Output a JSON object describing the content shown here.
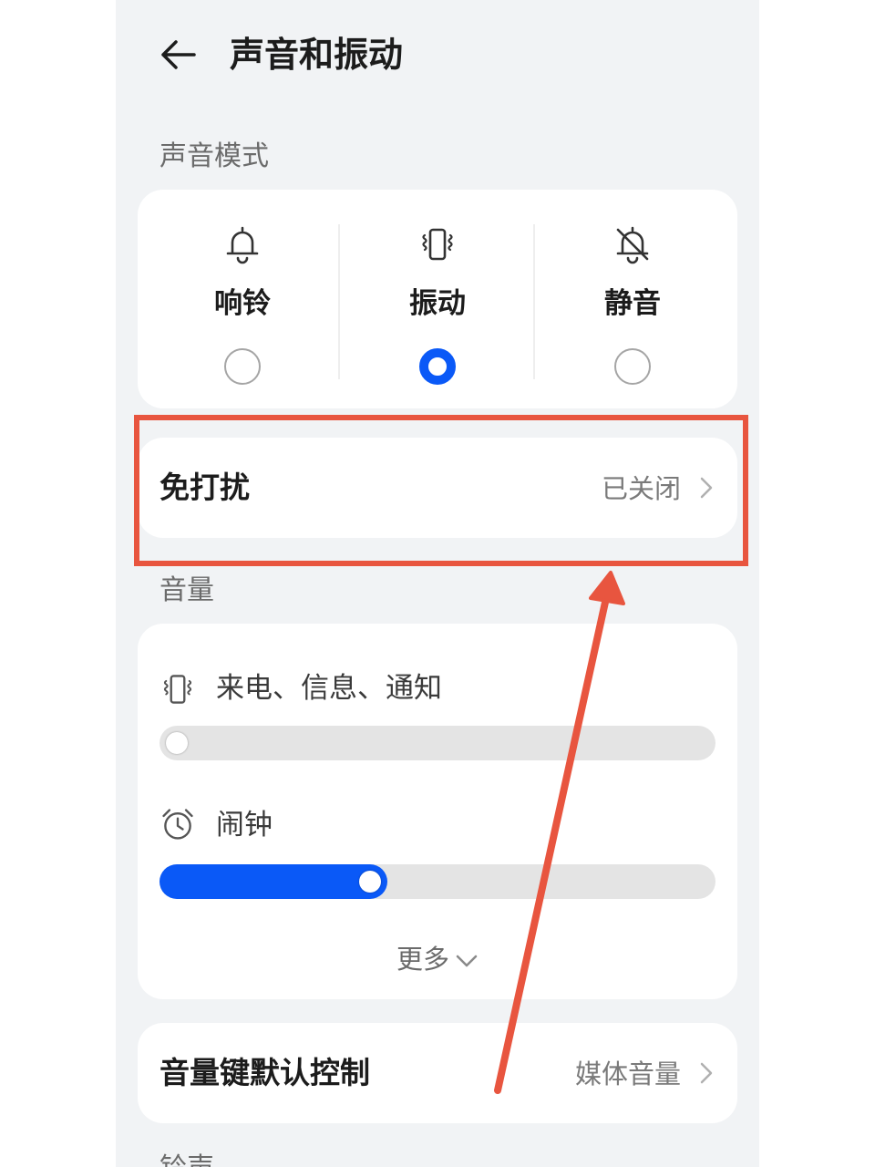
{
  "header": {
    "title": "声音和振动"
  },
  "sound_mode": {
    "section_label": "声音模式",
    "options": [
      {
        "label": "响铃",
        "icon": "bell-icon",
        "selected": false
      },
      {
        "label": "振动",
        "icon": "vibrate-icon",
        "selected": true
      },
      {
        "label": "静音",
        "icon": "bell-off-icon",
        "selected": false
      }
    ]
  },
  "dnd": {
    "title": "免打扰",
    "value": "已关闭"
  },
  "volume": {
    "section_label": "音量",
    "rows": [
      {
        "label": "来电、信息、通知",
        "icon": "vibrate-icon",
        "level": 0.0
      },
      {
        "label": "闹钟",
        "icon": "alarm-clock-icon",
        "level": 0.37
      }
    ],
    "more_label": "更多"
  },
  "volume_key": {
    "title": "音量键默认控制",
    "value": "媒体音量"
  },
  "cut_off_label": "铃声",
  "colors": {
    "accent": "#0a59f7",
    "annotation": "#e8553f",
    "background": "#f1f3f5"
  }
}
